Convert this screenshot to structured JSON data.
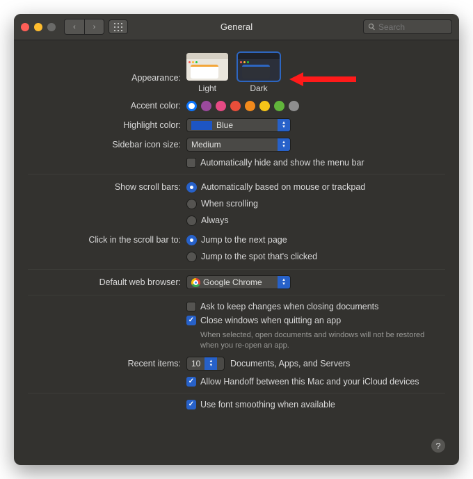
{
  "window": {
    "title": "General"
  },
  "search": {
    "placeholder": "Search"
  },
  "labels": {
    "appearance": "Appearance:",
    "accent": "Accent color:",
    "highlight": "Highlight color:",
    "sidebar": "Sidebar icon size:",
    "scrollbars": "Show scroll bars:",
    "scrollclick": "Click in the scroll bar to:",
    "browser": "Default web browser:",
    "recent": "Recent items:"
  },
  "appearance": {
    "light": "Light",
    "dark": "Dark",
    "selected": "Dark"
  },
  "accent_colors": [
    "#0b75ff",
    "#9b4a9d",
    "#e54a84",
    "#e94e3a",
    "#f28a1c",
    "#f5c518",
    "#61b53b",
    "#8e8e8e"
  ],
  "accent_selected_index": 0,
  "highlight": {
    "value": "Blue"
  },
  "sidebar_size": {
    "value": "Medium"
  },
  "menubar_autohide": {
    "label": "Automatically hide and show the menu bar",
    "checked": false
  },
  "scrollbars": {
    "options": [
      "Automatically based on mouse or trackpad",
      "When scrolling",
      "Always"
    ],
    "selected_index": 0
  },
  "scrollclick": {
    "options": [
      "Jump to the next page",
      "Jump to the spot that's clicked"
    ],
    "selected_index": 0
  },
  "browser": {
    "value": "Google Chrome"
  },
  "doc_close": {
    "ask": {
      "label": "Ask to keep changes when closing documents",
      "checked": false
    },
    "close": {
      "label": "Close windows when quitting an app",
      "checked": true
    },
    "note": "When selected, open documents and windows will not be restored when you re-open an app."
  },
  "recent": {
    "value": "10",
    "suffix": "Documents, Apps, and Servers"
  },
  "handoff": {
    "label": "Allow Handoff between this Mac and your iCloud devices",
    "checked": true
  },
  "fontsmooth": {
    "label": "Use font smoothing when available",
    "checked": true
  }
}
